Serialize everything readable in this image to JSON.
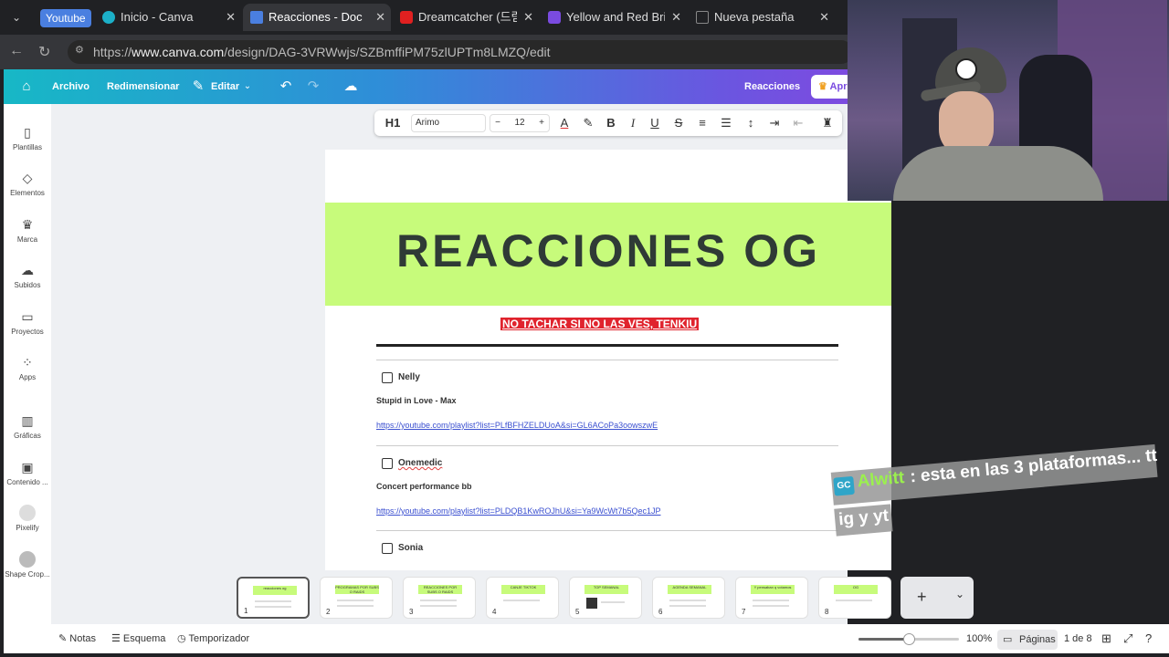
{
  "browser": {
    "tab_group_label": "Youtube",
    "tabs": [
      {
        "label": "Inicio - Canva",
        "icon": "canva-icon",
        "icon_color": "#1cb0c8"
      },
      {
        "label": "Reacciones - Doc",
        "icon": "doc-icon",
        "icon_color": "#4a7fe0",
        "active": true
      },
      {
        "label": "Dreamcatcher (드림캐",
        "icon": "youtube-icon",
        "icon_color": "#e02020"
      },
      {
        "label": "Yellow and Red Bright",
        "icon": "canva-icon",
        "icon_color": "#7a4be0"
      },
      {
        "label": "Nueva pestaña",
        "icon": "page-icon",
        "icon_color": "#888888"
      }
    ],
    "url_prefix": "https://",
    "url_domain": "www.canva.com",
    "url_path": "/design/DAG-3VRWwjs/SZBmffiPM75zlUPTm8LMZQ/edit"
  },
  "appbar": {
    "archivo": "Archivo",
    "redimensionar": "Redimensionar",
    "editar": "Editar",
    "doc_name": "Reacciones",
    "pro_label": "Apr"
  },
  "sidebar": {
    "items": [
      {
        "label": "Plantillas",
        "icon": "templates-icon"
      },
      {
        "label": "Elementos",
        "icon": "elements-icon"
      },
      {
        "label": "Marca",
        "icon": "brand-icon"
      },
      {
        "label": "Subidos",
        "icon": "upload-icon"
      },
      {
        "label": "Proyectos",
        "icon": "folder-icon"
      },
      {
        "label": "Apps",
        "icon": "apps-icon"
      },
      {
        "label": "Gráficas",
        "icon": "charts-icon"
      },
      {
        "label": "Contenido ...",
        "icon": "content-icon"
      },
      {
        "label": "Pixelify",
        "icon": "pixelify-icon"
      },
      {
        "label": "Shape Crop...",
        "icon": "shape-crop-icon"
      }
    ]
  },
  "toolbar": {
    "heading": "H1",
    "font": "Arimo",
    "size_minus": "−",
    "size": "12",
    "size_plus": "+"
  },
  "document": {
    "title": "REACCIONES OG",
    "warning": "NO TACHAR SI NO LAS VES, TENKIU",
    "entries": [
      {
        "name": "Nelly",
        "song": "Stupid in Love - Max",
        "link": "https://youtube.com/playlist?list=PLfBFHZELDUoA&si=GL6ACoPa3oowszwE"
      },
      {
        "name": "Onemedic",
        "song": "Concert performance bb",
        "link": "https://youtube.com/playlist?list=PLDQB1KwROJhU&si=Ya9WcWt7b5Qec1JP"
      },
      {
        "name": "Sonia",
        "song": "",
        "link": ""
      }
    ]
  },
  "pages": {
    "thumbs": [
      {
        "num": "1",
        "title": "reacciones og"
      },
      {
        "num": "2",
        "title": "PROGRAMAS POR SUBS O RAIDS"
      },
      {
        "num": "3",
        "title": "REACCIONES POR SUBS O RAIDS"
      },
      {
        "num": "4",
        "title": "CANJE TIKTOK"
      },
      {
        "num": "5",
        "title": "TOP SEMANAL"
      },
      {
        "num": "6",
        "title": "AGENDA SEMANAL"
      },
      {
        "num": "7",
        "title": "Y pensaban q votamos"
      },
      {
        "num": "8",
        "title": "OG"
      }
    ],
    "add_label": "+"
  },
  "footer": {
    "notas": "Notas",
    "esquema": "Esquema",
    "temporizador": "Temporizador",
    "zoom": "100%",
    "zoom_fraction": 0.5,
    "paginas": "Páginas",
    "page_count": "1 de 8"
  },
  "chat": {
    "badge": "GC",
    "user": "Alwitt",
    "message_line1": ": esta en las 3 plataformas... tt",
    "message_line2": "ig y yt"
  }
}
